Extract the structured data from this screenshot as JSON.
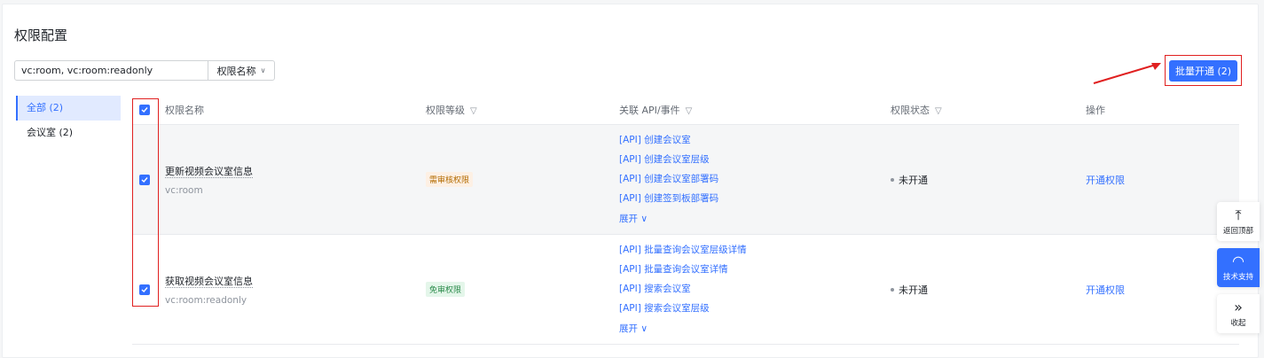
{
  "page": {
    "title": "权限配置"
  },
  "search": {
    "value": "vc:room, vc:room:readonly",
    "select_label": "权限名称"
  },
  "batch_button": "批量开通 (2)",
  "categories": [
    {
      "label": "全部 (2)",
      "active": true
    },
    {
      "label": "会议室 (2)",
      "active": false
    }
  ],
  "table": {
    "headers": {
      "name": "权限名称",
      "level": "权限等级",
      "api": "关联 API/事件",
      "status": "权限状态",
      "op": "操作"
    },
    "rows": [
      {
        "name": "更新视频会议室信息",
        "key": "vc:room",
        "level": "需审核权限",
        "level_type": "warn",
        "apis": [
          "[API] 创建会议室",
          "[API] 创建会议室层级",
          "[API] 创建会议室部署码",
          "[API] 创建签到板部署码"
        ],
        "expand": "展开",
        "status": "未开通",
        "op": "开通权限"
      },
      {
        "name": "获取视频会议室信息",
        "key": "vc:room:readonly",
        "level": "免审权限",
        "level_type": "ok",
        "apis": [
          "[API] 批量查询会议室层级详情",
          "[API] 批量查询会议室详情",
          "[API] 搜索会议室",
          "[API] 搜索会议室层级"
        ],
        "expand": "展开",
        "status": "未开通",
        "op": "开通权限"
      }
    ]
  },
  "float_buttons": {
    "top": "返回顶部",
    "support": "技术支持",
    "collapse": "收起"
  },
  "colors": {
    "accent": "#3370ff",
    "annotation": "#e02020"
  }
}
